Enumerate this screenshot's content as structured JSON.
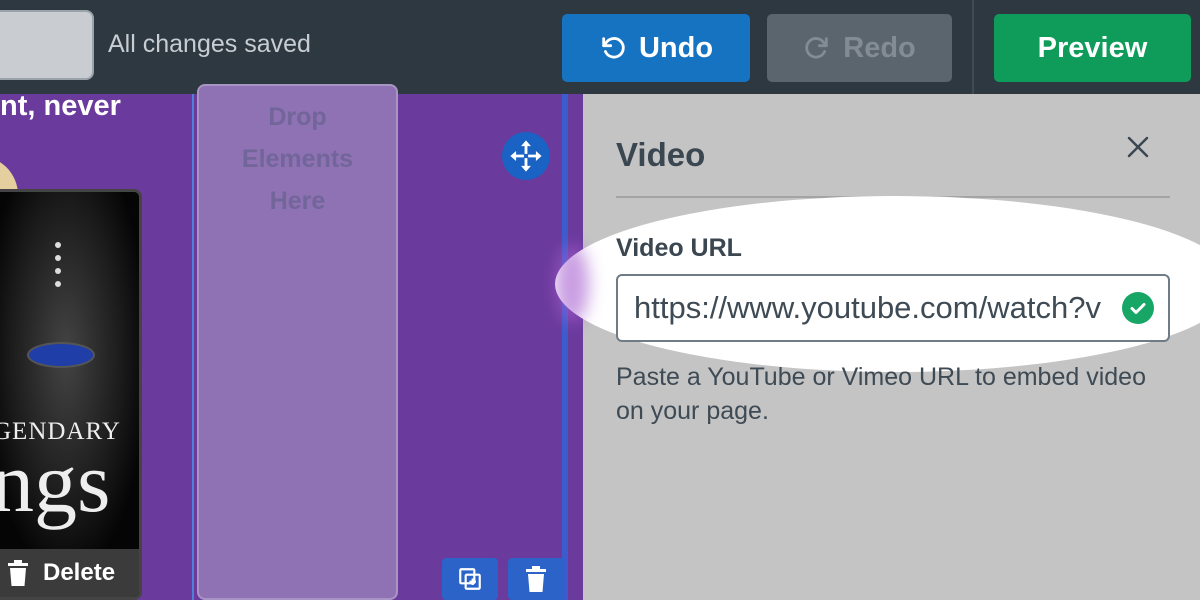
{
  "header": {
    "save_status": "All changes saved",
    "undo_label": "Undo",
    "redo_label": "Redo",
    "preview_label": "Preview"
  },
  "canvas": {
    "heading_fragment": "nt, never",
    "drop_zone_lines": [
      "Drop",
      "Elements",
      "Here"
    ],
    "card_title_line1": "GENDARY",
    "card_title_line2": "ngs",
    "delete_label": "Delete"
  },
  "panel": {
    "title": "Video",
    "field_label": "Video URL",
    "url_value": "https://www.youtube.com/watch?v",
    "help_text": "Paste a YouTube or Vimeo URL to embed video on your page."
  },
  "colors": {
    "topbar": "#2d3841",
    "undo_blue": "#1573c2",
    "preview_green": "#0f9b5a",
    "canvas_purple": "#6a3a9c",
    "panel_gray": "#c4c4c4",
    "valid_green": "#17a665"
  }
}
